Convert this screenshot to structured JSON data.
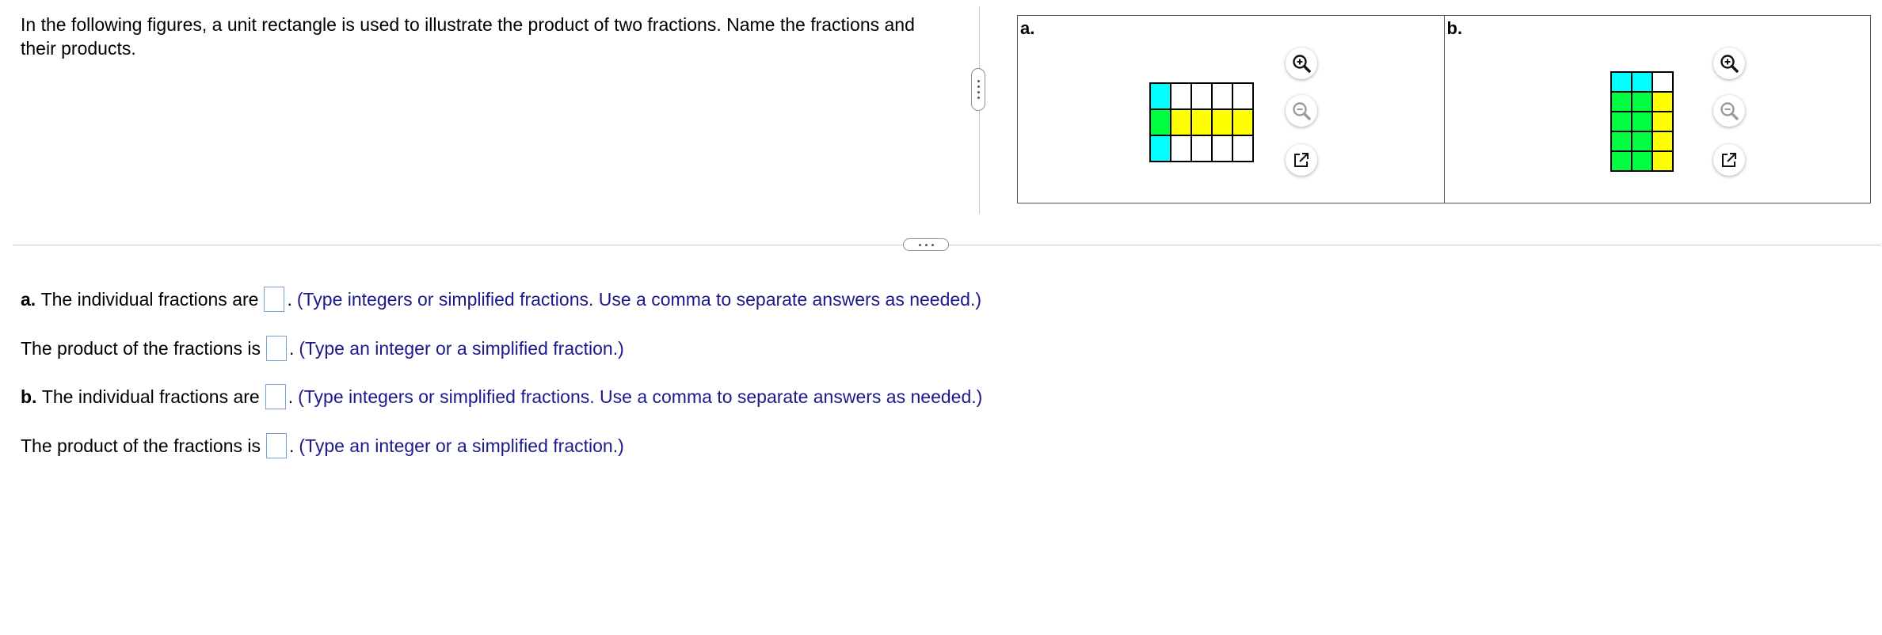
{
  "question": {
    "text": "In the following figures, a unit rectangle is used to illustrate the product of two fractions. Name the fractions and their products."
  },
  "figures": {
    "a": {
      "label": "a.",
      "grid": [
        [
          "cyan",
          "white",
          "white",
          "white",
          "white"
        ],
        [
          "green",
          "yellow",
          "yellow",
          "yellow",
          "yellow"
        ],
        [
          "cyan",
          "white",
          "white",
          "white",
          "white"
        ]
      ]
    },
    "b": {
      "label": "b.",
      "grid": [
        [
          "cyan",
          "cyan",
          "white"
        ],
        [
          "green",
          "green",
          "yellow"
        ],
        [
          "green",
          "green",
          "yellow"
        ],
        [
          "green",
          "green",
          "yellow"
        ],
        [
          "green",
          "green",
          "yellow"
        ]
      ]
    },
    "tools": [
      "zoom-in-icon",
      "zoom-out-icon",
      "open-new-window-icon"
    ]
  },
  "colors": {
    "cyan": "#00ffff",
    "green": "#00ff40",
    "yellow": "#ffff00",
    "hint": "#1a1a8c",
    "input_border": "#7aa0d8"
  },
  "answers": {
    "a_label": "a.",
    "a_fractions_text": "The individual fractions are",
    "a_product_text": "The product of the fractions is",
    "b_label": "b.",
    "b_fractions_text": "The individual fractions are",
    "b_product_text": "The product of the fractions is",
    "period": ".",
    "hint_fractions": "(Type integers or simplified fractions. Use a comma to separate answers as needed.)",
    "hint_product": "(Type an integer or a simplified fraction.)",
    "a_fractions_value": "",
    "a_product_value": "",
    "b_fractions_value": "",
    "b_product_value": ""
  }
}
